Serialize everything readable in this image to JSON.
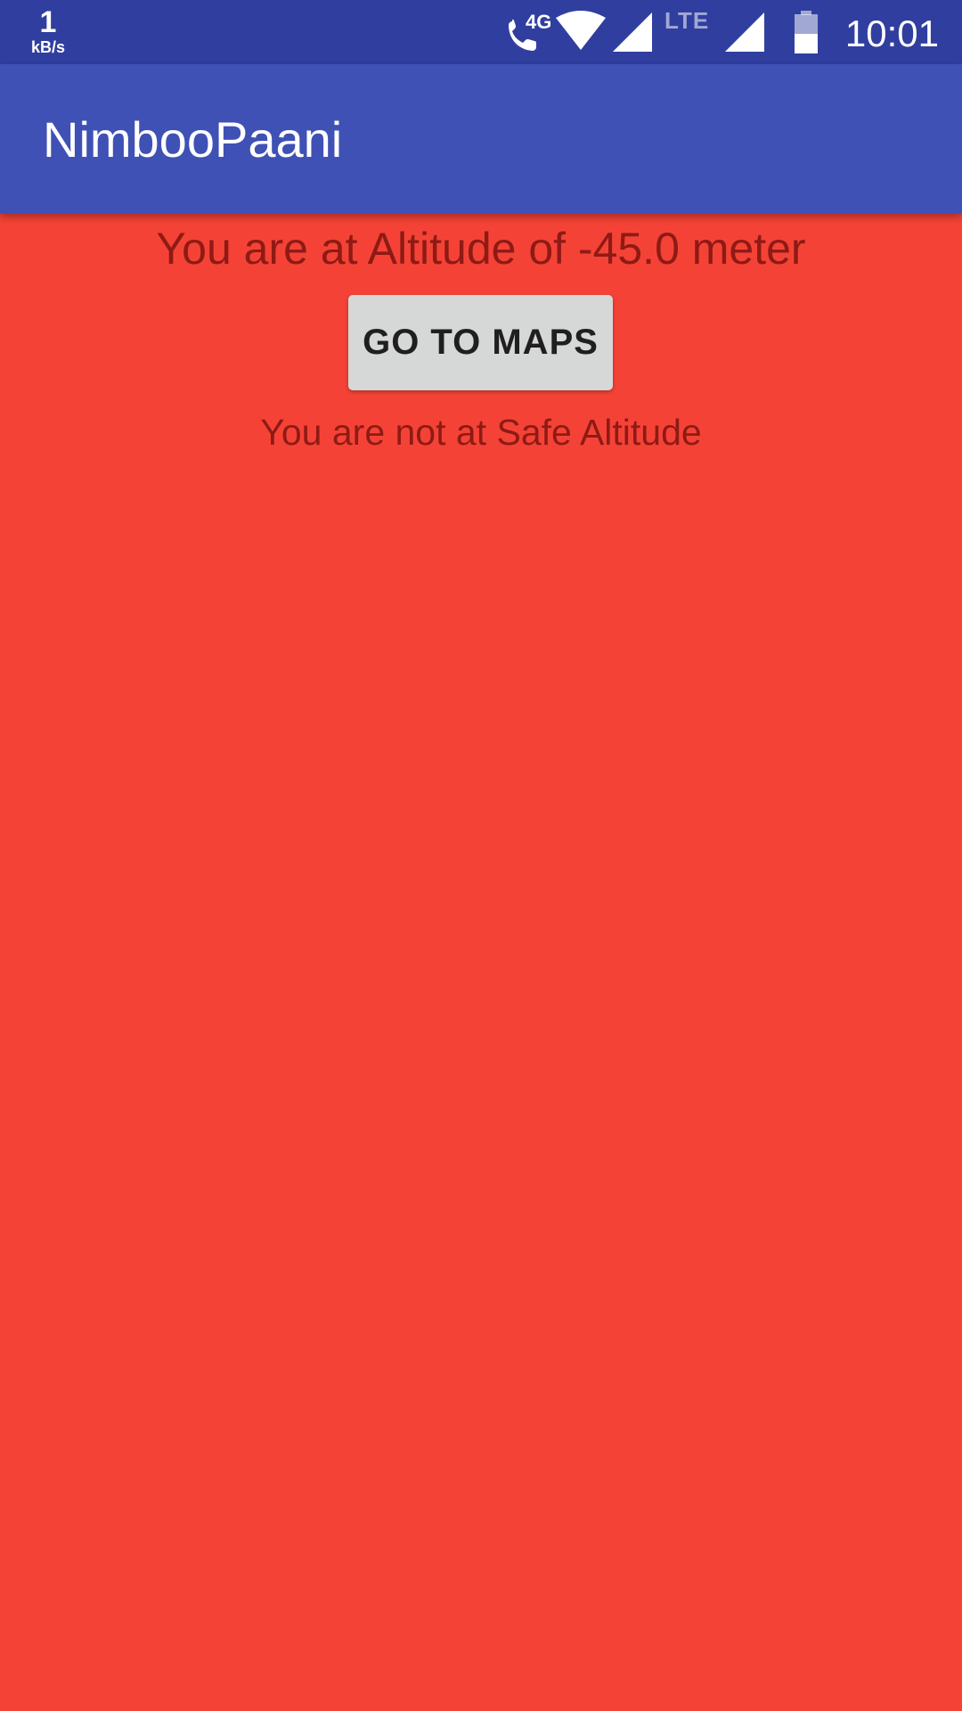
{
  "status_bar": {
    "net_speed_value": "1",
    "net_speed_unit": "kB/s",
    "call_network_label": "4G",
    "lte_label": "LTE",
    "time": "10:01",
    "icons": [
      "call-4g-icon",
      "wifi-icon",
      "signal-icon",
      "lte-signal-icon",
      "battery-icon"
    ],
    "battery_level": 0.5
  },
  "app_bar": {
    "title": "NimbooPaani"
  },
  "main": {
    "altitude_text": "You are at Altitude of -45.0 meter",
    "maps_button_label": "GO TO MAPS",
    "safety_status": "You are not at Safe Altitude"
  },
  "colors": {
    "status_bar": "#303F9F",
    "app_bar": "#3F51B5",
    "background": "#F44336",
    "text": "#8E1A15",
    "button": "#D6D7D7"
  }
}
